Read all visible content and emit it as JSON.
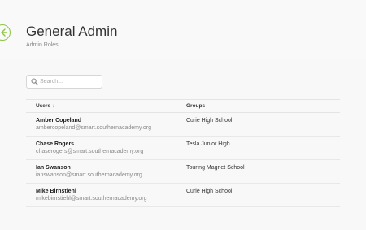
{
  "header": {
    "title": "General Admin",
    "subtitle": "Admin Roles",
    "accent_color": "#8cc63f"
  },
  "search": {
    "placeholder": "Search...",
    "value": ""
  },
  "table": {
    "columns": {
      "users": "Users",
      "users_sort_indicator": "↓",
      "groups": "Groups"
    },
    "rows": [
      {
        "name": "Amber Copeland",
        "email": "ambercopeland@smart.southernacademy.org",
        "group": "Curie High School"
      },
      {
        "name": "Chase Rogers",
        "email": "chaserogers@smart.southernacademy.org",
        "group": "Tesla Junior High"
      },
      {
        "name": "Ian Swanson",
        "email": "ianswanson@smart.southernacademy.org",
        "group": "Touring Magnet School"
      },
      {
        "name": "Mike Birnstiehl",
        "email": "mikebirnstiehl@smart.southernacademy.org",
        "group": "Curie High School"
      }
    ]
  }
}
